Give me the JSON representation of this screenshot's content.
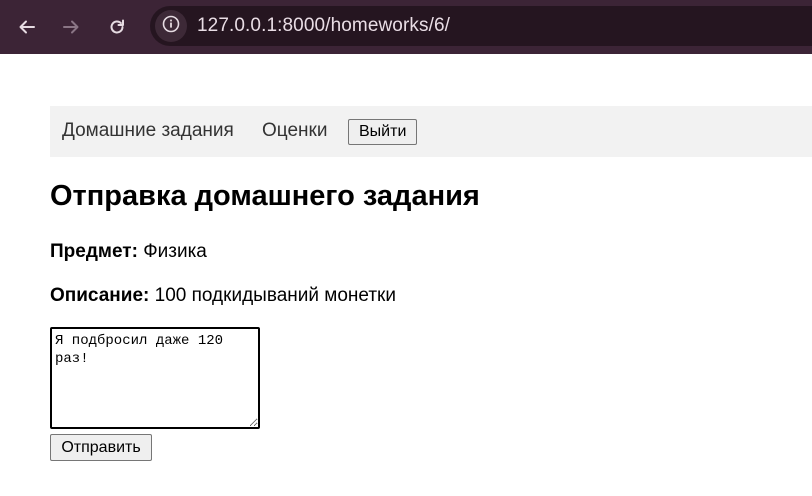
{
  "browser": {
    "url": "127.0.0.1:8000/homeworks/6/",
    "icons": {
      "back": "arrow-left-icon",
      "forward": "arrow-right-icon",
      "reload": "reload-icon",
      "site_info": "info-icon"
    },
    "colors": {
      "chrome_bg": "#3c2436",
      "omnibox_bg": "#251520",
      "url_text": "#e9dde5"
    }
  },
  "nav": {
    "homeworks_label": "Домашние задания",
    "grades_label": "Оценки",
    "logout_label": "Выйти"
  },
  "main": {
    "title": "Отправка домашнего задания",
    "subject_label": "Предмет:",
    "subject_value": "Физика",
    "description_label": "Описание:",
    "description_value": "100 подкидываний монетки",
    "answer_text": "Я подбросил даже 120 раз!",
    "submit_label": "Отправить"
  }
}
